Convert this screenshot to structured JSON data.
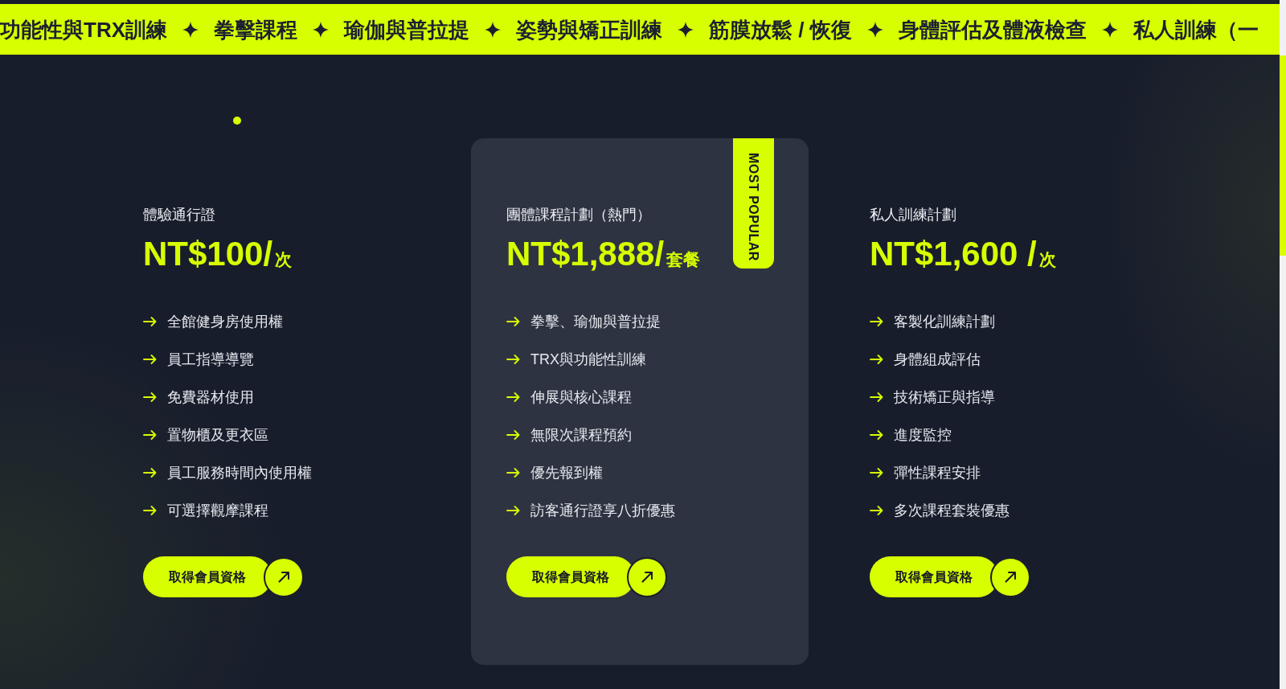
{
  "ticker": [
    "功能性與TRX訓練",
    "拳擊課程",
    "瑜伽與普拉提",
    "姿勢與矯正訓練",
    "筋膜放鬆 / 恢復",
    "身體評估及體液檢查",
    "私人訓練（一"
  ],
  "plans": [
    {
      "title": "體驗通行證",
      "price": "NT$100/",
      "unit": "次",
      "featured": false,
      "features": [
        "全館健身房使用權",
        "員工指導導覽",
        "免費器材使用",
        "置物櫃及更衣區",
        "員工服務時間內使用權",
        "可選擇觀摩課程"
      ],
      "button": "取得會員資格"
    },
    {
      "title": "團體課程計劃（熱門）",
      "price": "NT$1,888/",
      "unit": "套餐",
      "featured": true,
      "badge": "MOST POPULAR",
      "features": [
        "拳擊、瑜伽與普拉提",
        "TRX與功能性訓練",
        "伸展與核心課程",
        "無限次課程預約",
        "優先報到權",
        "訪客通行證享八折優惠"
      ],
      "button": "取得會員資格"
    },
    {
      "title": "私人訓練計劃",
      "price": "NT$1,600 /",
      "unit": "次",
      "featured": false,
      "features": [
        "客製化訓練計劃",
        "身體組成評估",
        "技術矯正與指導",
        "進度監控",
        "彈性課程安排",
        "多次課程套裝優惠"
      ],
      "button": "取得會員資格"
    }
  ]
}
